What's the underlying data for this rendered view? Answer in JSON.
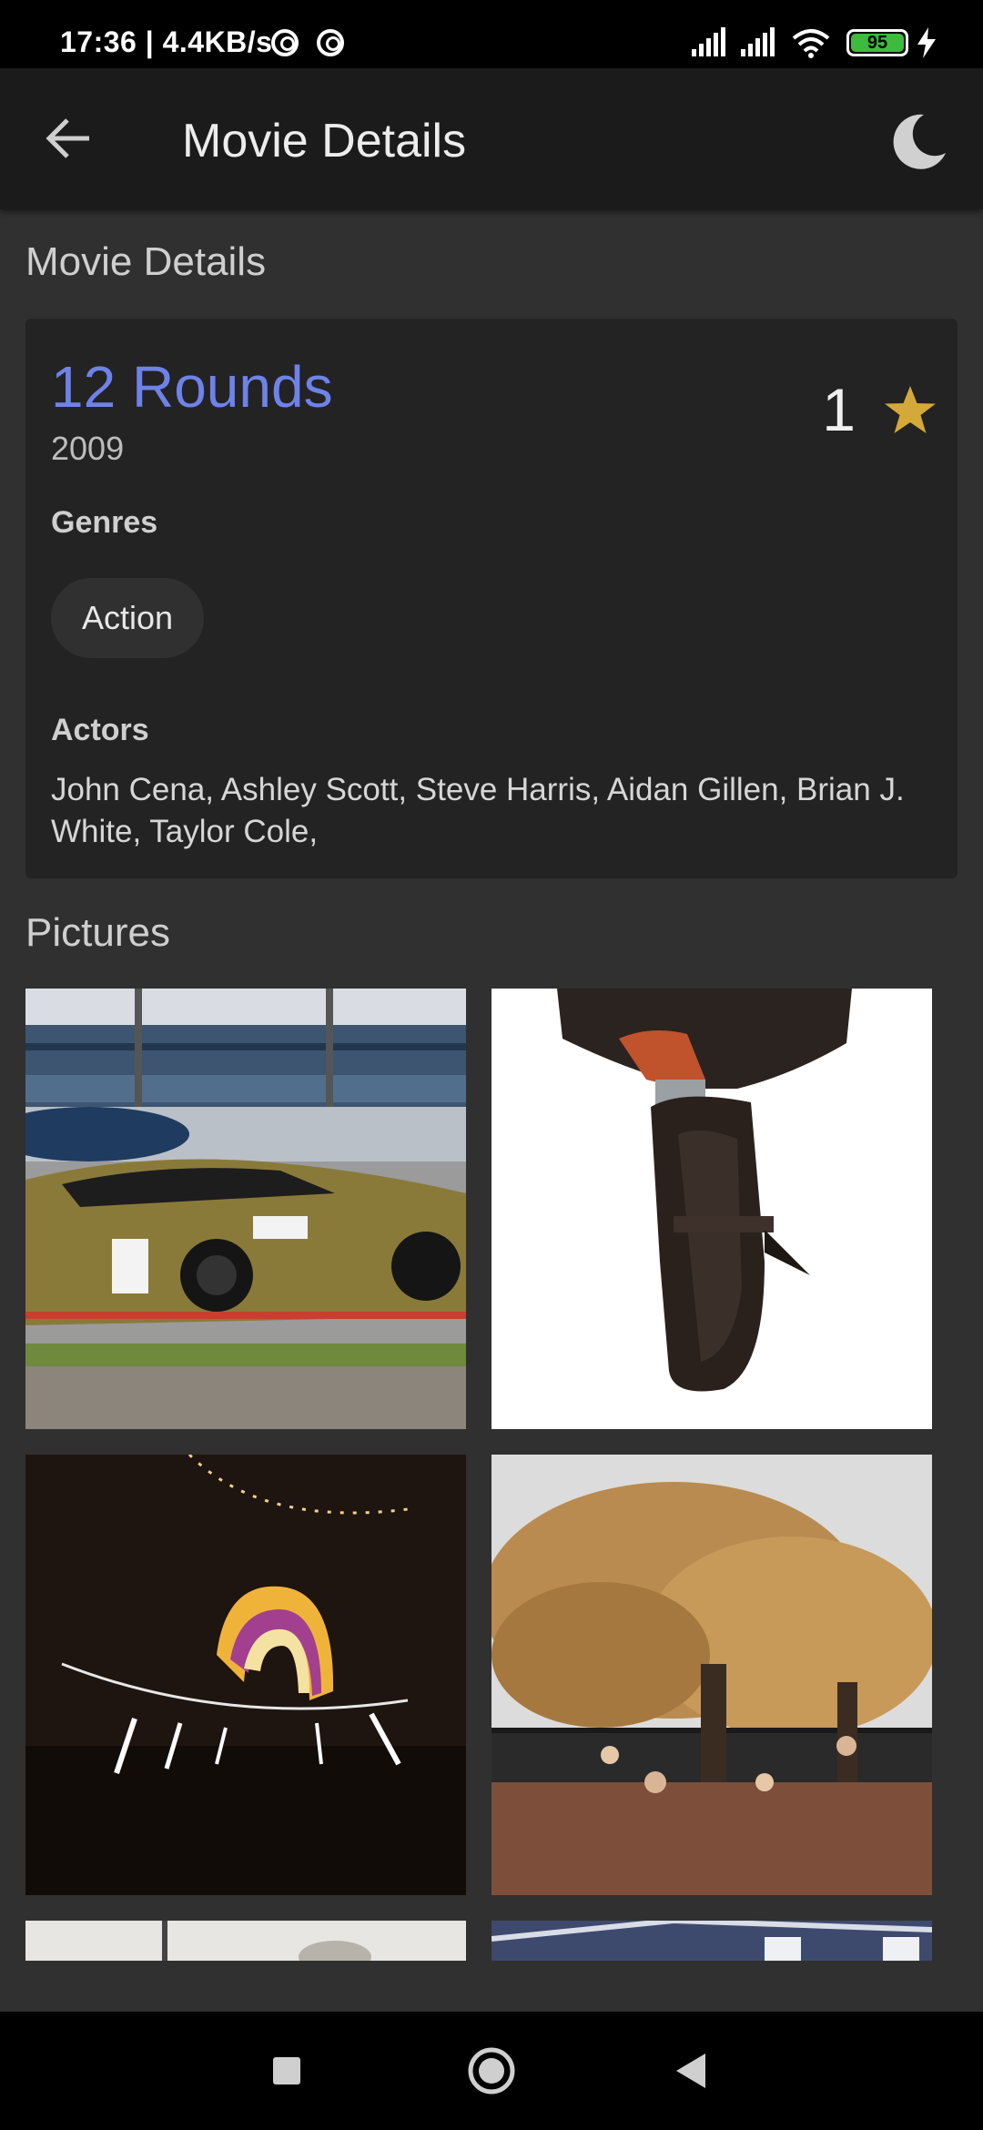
{
  "status_bar": {
    "time": "17:36 | 4.4KB/s",
    "battery": "95"
  },
  "app_bar": {
    "title": "Movie Details"
  },
  "section_details_heading": "Movie Details",
  "movie": {
    "title": "12 Rounds",
    "year": "2009",
    "rating": "1",
    "genres_label": "Genres",
    "genres": [
      "Action"
    ],
    "actors_label": "Actors",
    "actors": "John Cena, Ashley Scott, Steve Harris, Aidan Gillen, Brian J. White, Taylor Cole,"
  },
  "section_pictures_heading": "Pictures",
  "pictures": [
    {
      "name": "race-car-photo"
    },
    {
      "name": "revolver-holster-photo"
    },
    {
      "name": "night-lantern-photo"
    },
    {
      "name": "autumn-tree-photo"
    },
    {
      "name": "partial-photo"
    },
    {
      "name": "partial-photo"
    }
  ],
  "colors": {
    "accent_title": "#6f82ea",
    "star": "#d4a93a",
    "background": "#303030",
    "card": "#232323"
  },
  "icons": {
    "back": "arrow-left-icon",
    "theme": "moon-icon",
    "rating": "star-icon",
    "nav_recents": "square-icon",
    "nav_home": "circle-icon",
    "nav_back": "triangle-icon"
  }
}
